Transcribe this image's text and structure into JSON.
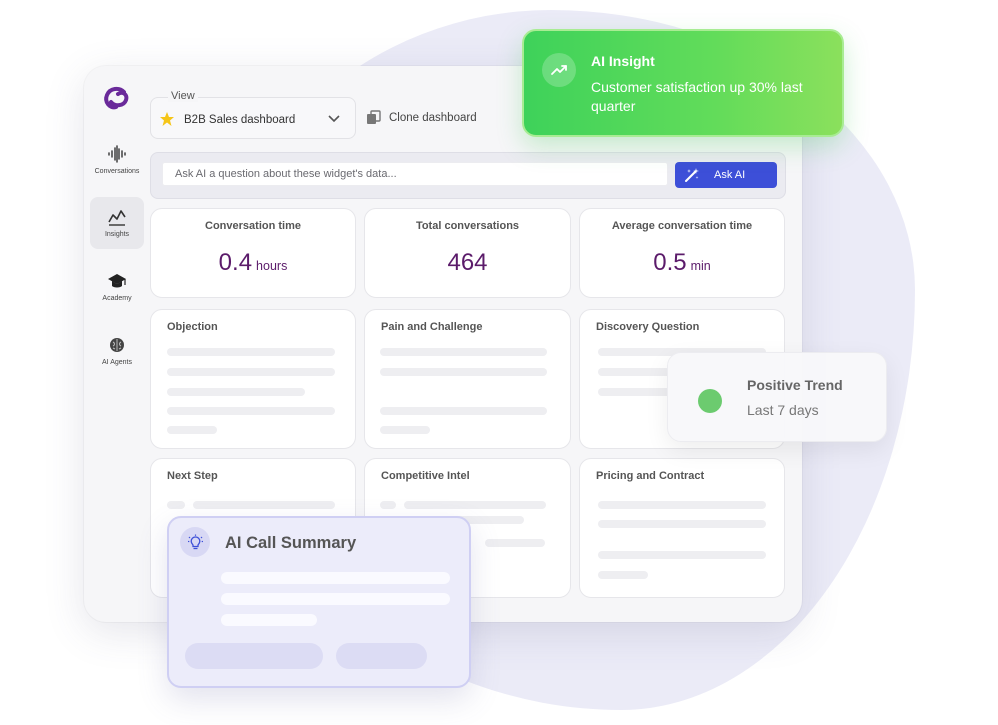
{
  "sidebar": {
    "items": [
      {
        "label": "Conversations",
        "icon": "waveform-icon"
      },
      {
        "label": "Insights",
        "icon": "chart-icon",
        "active": true
      },
      {
        "label": "Academy",
        "icon": "graduation-cap-icon"
      },
      {
        "label": "AI Agents",
        "icon": "brain-icon"
      }
    ]
  },
  "toolbar": {
    "view_label": "View",
    "view_value": "B2B Sales dashboard",
    "clone_label": "Clone dashboard"
  },
  "ask": {
    "placeholder": "Ask AI a question about these widget's data...",
    "button_label": "Ask AI"
  },
  "stats": [
    {
      "title": "Conversation time",
      "value": "0.4",
      "unit": "hours"
    },
    {
      "title": "Total conversations",
      "value": "464",
      "unit": ""
    },
    {
      "title": "Average conversation time",
      "value": "0.5",
      "unit": "min"
    }
  ],
  "widgets": [
    {
      "title": "Objection"
    },
    {
      "title": "Pain and Challenge"
    },
    {
      "title": "Discovery Question"
    },
    {
      "title": "Next Step"
    },
    {
      "title": "Competitive Intel"
    },
    {
      "title": "Pricing and Contract"
    }
  ],
  "insight": {
    "title": "AI Insight",
    "text": "Customer satisfaction up 30% last quarter"
  },
  "trend": {
    "title": "Positive Trend",
    "subtitle": "Last 7 days"
  },
  "summary": {
    "title": "AI Call Summary"
  },
  "colors": {
    "brand": "#5b1b8a",
    "accent": "#3d4fd8",
    "positive": "#3ed25a",
    "stat_value": "#5b1b6a"
  }
}
